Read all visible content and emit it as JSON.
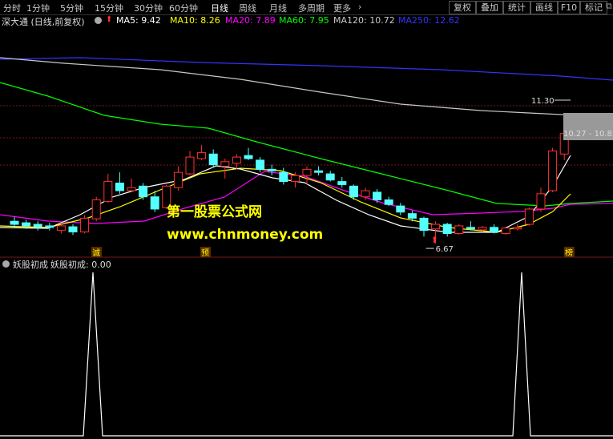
{
  "toolbar": {
    "periods": [
      "分时",
      "1分钟",
      "5分钟",
      "15分钟",
      "30分钟",
      "60分钟",
      "日线",
      "周线",
      "月线",
      "多周期",
      "更多"
    ],
    "more_arrow": "›",
    "right_buttons": [
      "复权",
      "叠加",
      "统计",
      "画线",
      "F10",
      "标记"
    ],
    "window_icon": "⧉"
  },
  "main": {
    "title": "深大通 (日线,前复权)",
    "ma": [
      {
        "label": "MA5: 9.42",
        "color": "#ffffff"
      },
      {
        "label": "MA10: 8.26",
        "color": "#ffff00"
      },
      {
        "label": "MA20: 7.89",
        "color": "#ff00ff"
      },
      {
        "label": "MA60: 7.95",
        "color": "#00ff00"
      },
      {
        "label": "MA120: 10.72",
        "color": "#c8c8c8"
      },
      {
        "label": "MA250: 12.62",
        "color": "#3333ff"
      }
    ],
    "watermark_cn": "第一股票公式网",
    "watermark_url": "www.chnmoney.com",
    "high_label": "11.30",
    "low_label": "6.67",
    "price_box": "10.27 - 10.82",
    "signals": [
      "诚",
      "预",
      "榜"
    ],
    "colors": {
      "up": "#ff3232",
      "down": "#54ffff",
      "grid": "#7a1a1a"
    }
  },
  "indicator": {
    "title": "妖股初成",
    "value_label": "妖股初成: 0.00"
  },
  "chart_data": {
    "type": "candlestick",
    "price_range": [
      6.2,
      13.8
    ],
    "candles": [
      [
        7.4,
        7.3,
        7.55,
        7.2
      ],
      [
        7.35,
        7.25,
        7.45,
        7.15
      ],
      [
        7.3,
        7.22,
        7.4,
        7.1
      ],
      [
        7.25,
        7.2,
        7.35,
        7.1
      ],
      [
        7.1,
        7.25,
        7.35,
        7.0
      ],
      [
        7.22,
        7.05,
        7.3,
        6.95
      ],
      [
        7.05,
        7.5,
        7.6,
        7.0
      ],
      [
        7.48,
        8.1,
        8.2,
        7.4
      ],
      [
        8.05,
        8.7,
        8.95,
        8.0
      ],
      [
        8.65,
        8.4,
        9.0,
        8.3
      ],
      [
        8.4,
        8.5,
        8.8,
        8.35
      ],
      [
        8.55,
        8.2,
        8.65,
        8.1
      ],
      [
        8.2,
        7.8,
        8.4,
        7.7
      ],
      [
        7.85,
        8.55,
        8.6,
        7.8
      ],
      [
        8.5,
        9.0,
        9.2,
        8.4
      ],
      [
        8.95,
        9.5,
        9.7,
        8.9
      ],
      [
        9.45,
        9.65,
        9.9,
        9.4
      ],
      [
        9.6,
        9.25,
        9.75,
        9.15
      ],
      [
        9.2,
        9.35,
        9.45,
        8.8
      ],
      [
        9.3,
        9.5,
        9.6,
        9.1
      ],
      [
        9.55,
        9.45,
        9.8,
        9.4
      ],
      [
        9.4,
        9.1,
        9.5,
        9.0
      ],
      [
        9.1,
        9.05,
        9.25,
        8.9
      ],
      [
        9.0,
        8.7,
        9.15,
        8.6
      ],
      [
        8.7,
        8.9,
        9.0,
        8.5
      ],
      [
        8.9,
        9.1,
        9.2,
        8.6
      ],
      [
        9.05,
        9.0,
        9.2,
        8.9
      ],
      [
        8.95,
        8.75,
        9.05,
        8.7
      ],
      [
        8.7,
        8.6,
        8.85,
        8.5
      ],
      [
        8.55,
        8.2,
        8.6,
        8.1
      ],
      [
        8.2,
        8.4,
        8.5,
        8.1
      ],
      [
        8.35,
        8.1,
        8.45,
        8.0
      ],
      [
        8.1,
        7.95,
        8.2,
        7.9
      ],
      [
        7.9,
        7.7,
        8.0,
        7.6
      ],
      [
        7.65,
        7.5,
        7.75,
        7.4
      ],
      [
        7.5,
        7.1,
        7.55,
        6.9
      ],
      [
        7.15,
        7.3,
        7.4,
        6.67
      ],
      [
        7.3,
        7.0,
        7.35,
        6.9
      ],
      [
        7.0,
        7.25,
        7.3,
        6.95
      ],
      [
        7.2,
        7.15,
        7.4,
        7.1
      ],
      [
        7.12,
        7.2,
        7.25,
        7.05
      ],
      [
        7.2,
        7.05,
        7.3,
        7.0
      ],
      [
        7.0,
        7.18,
        7.22,
        6.95
      ],
      [
        7.15,
        7.2,
        7.3,
        7.1
      ],
      [
        7.3,
        7.8,
        7.85,
        7.25
      ],
      [
        7.8,
        8.3,
        8.5,
        7.7
      ],
      [
        8.4,
        9.7,
        9.8,
        8.35
      ],
      [
        9.6,
        10.27,
        10.82,
        9.4
      ]
    ]
  }
}
